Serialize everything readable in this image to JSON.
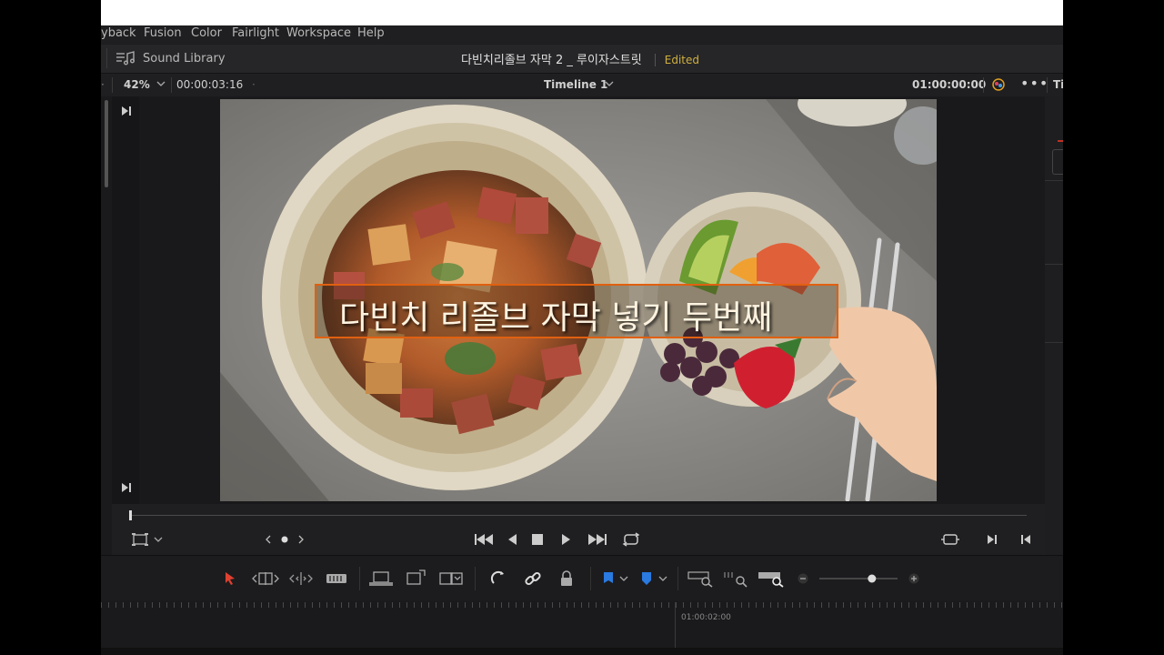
{
  "menu": {
    "items": [
      "yback",
      "Fusion",
      "Color",
      "Fairlight",
      "Workspace",
      "Help"
    ]
  },
  "header": {
    "sound_library": "Sound Library",
    "project_title": "다빈치리졸브 자막 2 _ 루이자스트릿",
    "edited": "Edited"
  },
  "viewer_bar": {
    "zoom": "42%",
    "timecode_left": "00:00:03:16",
    "timeline_name": "Timeline 1",
    "timecode_right": "01:00:00:00",
    "right_tab": "Ti"
  },
  "viewer": {
    "subtitle": "다빈치 리졸브 자막 넣기 두번째"
  },
  "timeline": {
    "ruler_timecode": "01:00:02:00",
    "zoom_level": 0.7
  },
  "colors": {
    "accent_orange": "#e06010",
    "edited_yellow": "#d0b040",
    "select_red": "#e04030",
    "flag_blue": "#2a7ae0"
  }
}
